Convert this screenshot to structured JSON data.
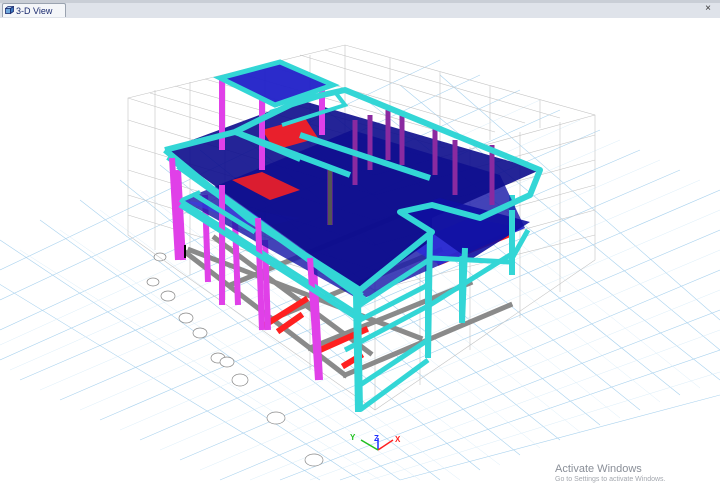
{
  "window": {
    "tab_label": "3-D View",
    "close_glyph": "×"
  },
  "icons": {
    "tab_icon": "3d-view-icon",
    "close_icon": "close-icon"
  },
  "axis_triad": {
    "x_label": "X",
    "y_label": "Y",
    "z_label": "Z",
    "colors": {
      "x": "#ff2020",
      "y": "#20c020",
      "z": "#2030ff"
    }
  },
  "grid_bubbles": [
    "",
    "",
    "",
    "",
    "",
    "",
    "",
    "",
    "",
    ""
  ],
  "watermark": {
    "title": "Activate Windows",
    "subtitle": "Go to Settings to activate Windows."
  },
  "colors": {
    "beam": "#33d6d6",
    "column": "#e040e8",
    "slab": "#1010a0",
    "slab_alt": "#3030e0",
    "red_beam": "#ff2020",
    "gray_beam": "#8a8a8a",
    "grid": "#9ccbe8"
  }
}
